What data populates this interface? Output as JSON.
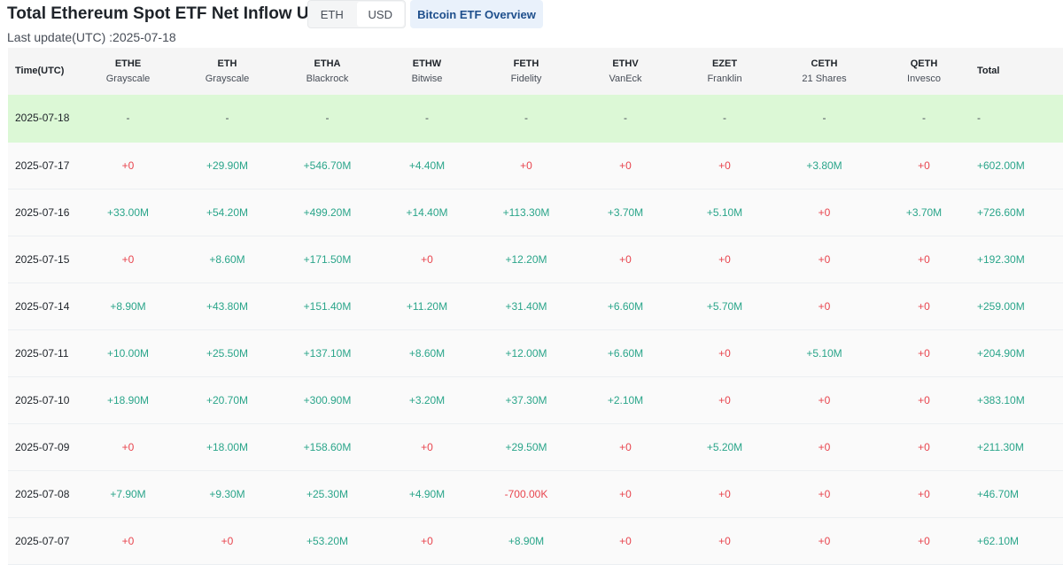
{
  "header": {
    "title": "Total Ethereum Spot ETF Net Inflow USD",
    "toggle": [
      "ETH",
      "USD"
    ],
    "toggle_active": "USD",
    "overview_button": "Bitcoin ETF Overview",
    "last_update": "Last update(UTC) :2025-07-18"
  },
  "colors": {
    "positive": "#2aa58a",
    "negative": "#e8454e",
    "highlight_row": "#dcf8d6",
    "overview_bg": "#e9f1fb"
  },
  "table": {
    "time_header": "Time(UTC)",
    "total_header": "Total",
    "columns": [
      {
        "symbol": "ETHE",
        "issuer": "Grayscale"
      },
      {
        "symbol": "ETH",
        "issuer": "Grayscale"
      },
      {
        "symbol": "ETHA",
        "issuer": "Blackrock"
      },
      {
        "symbol": "ETHW",
        "issuer": "Bitwise"
      },
      {
        "symbol": "FETH",
        "issuer": "Fidelity"
      },
      {
        "symbol": "ETHV",
        "issuer": "VanEck"
      },
      {
        "symbol": "EZET",
        "issuer": "Franklin"
      },
      {
        "symbol": "CETH",
        "issuer": "21 Shares"
      },
      {
        "symbol": "QETH",
        "issuer": "Invesco"
      }
    ],
    "rows": [
      {
        "date": "2025-07-18",
        "values": [
          "-",
          "-",
          "-",
          "-",
          "-",
          "-",
          "-",
          "-",
          "-"
        ],
        "total": "-"
      },
      {
        "date": "2025-07-17",
        "values": [
          "+0",
          "+29.90M",
          "+546.70M",
          "+4.40M",
          "+0",
          "+0",
          "+0",
          "+3.80M",
          "+0"
        ],
        "total": "+602.00M"
      },
      {
        "date": "2025-07-16",
        "values": [
          "+33.00M",
          "+54.20M",
          "+499.20M",
          "+14.40M",
          "+113.30M",
          "+3.70M",
          "+5.10M",
          "+0",
          "+3.70M"
        ],
        "total": "+726.60M"
      },
      {
        "date": "2025-07-15",
        "values": [
          "+0",
          "+8.60M",
          "+171.50M",
          "+0",
          "+12.20M",
          "+0",
          "+0",
          "+0",
          "+0"
        ],
        "total": "+192.30M"
      },
      {
        "date": "2025-07-14",
        "values": [
          "+8.90M",
          "+43.80M",
          "+151.40M",
          "+11.20M",
          "+31.40M",
          "+6.60M",
          "+5.70M",
          "+0",
          "+0"
        ],
        "total": "+259.00M"
      },
      {
        "date": "2025-07-11",
        "values": [
          "+10.00M",
          "+25.50M",
          "+137.10M",
          "+8.60M",
          "+12.00M",
          "+6.60M",
          "+0",
          "+5.10M",
          "+0"
        ],
        "total": "+204.90M"
      },
      {
        "date": "2025-07-10",
        "values": [
          "+18.90M",
          "+20.70M",
          "+300.90M",
          "+3.20M",
          "+37.30M",
          "+2.10M",
          "+0",
          "+0",
          "+0"
        ],
        "total": "+383.10M"
      },
      {
        "date": "2025-07-09",
        "values": [
          "+0",
          "+18.00M",
          "+158.60M",
          "+0",
          "+29.50M",
          "+0",
          "+5.20M",
          "+0",
          "+0"
        ],
        "total": "+211.30M"
      },
      {
        "date": "2025-07-08",
        "values": [
          "+7.90M",
          "+9.30M",
          "+25.30M",
          "+4.90M",
          "-700.00K",
          "+0",
          "+0",
          "+0",
          "+0"
        ],
        "total": "+46.70M"
      },
      {
        "date": "2025-07-07",
        "values": [
          "+0",
          "+0",
          "+53.20M",
          "+0",
          "+8.90M",
          "+0",
          "+0",
          "+0",
          "+0"
        ],
        "total": "+62.10M"
      }
    ]
  }
}
